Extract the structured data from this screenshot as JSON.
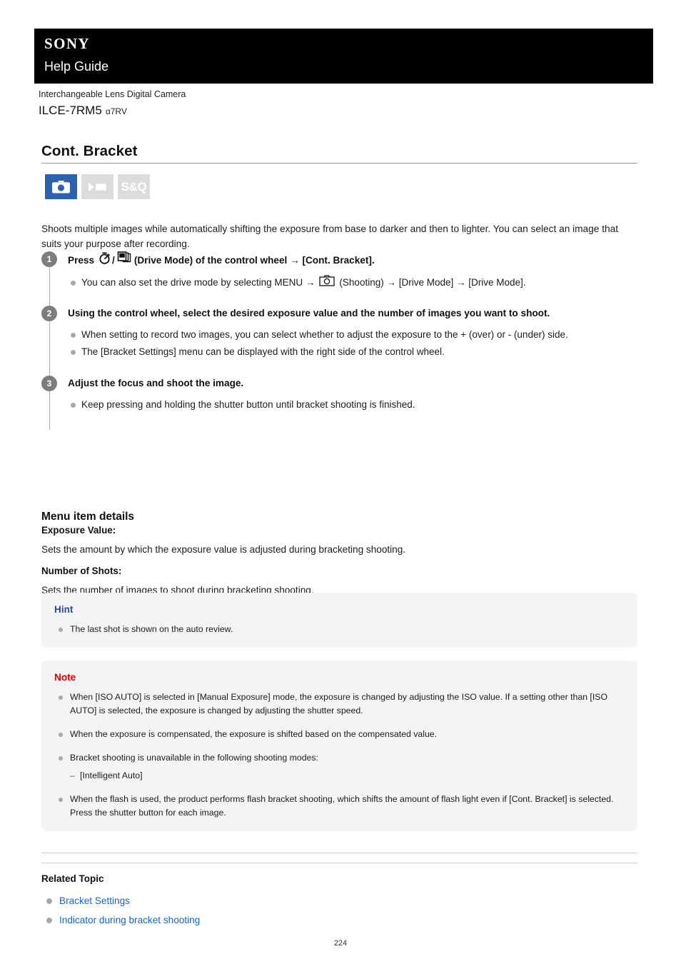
{
  "header": {
    "brand": "SONY",
    "subtitle": "Help Guide"
  },
  "product": {
    "category": "Interchangeable Lens Digital Camera",
    "model": "ILCE-7RM5",
    "alias": "α7RV"
  },
  "page_title": "Cont. Bracket",
  "mode_icons": [
    {
      "name": "still-photo-mode",
      "label": "",
      "state": "active"
    },
    {
      "name": "movie-mode",
      "label": "",
      "state": "inactive"
    },
    {
      "name": "slow-quick-mode",
      "label": "S&Q",
      "state": "inactive"
    }
  ],
  "intro": "Shoots multiple images while automatically shifting the exposure from base to darker and then to lighter. You can select an image that suits your purpose after recording.",
  "steps": [
    {
      "number": "1",
      "title_pre": "Press",
      "title_mid": "/",
      "title_post": "(Drive Mode) of the control wheel → [Cont. Bracket].",
      "bullets_pre": "You can also set the drive mode by selecting MENU →",
      "bullets_post": "(Shooting) → [Drive Mode] → [Drive Mode]."
    },
    {
      "number": "2",
      "title": "Using the control wheel, select the desired exposure value and the number of images you want to shoot.",
      "bullets": [
        "When setting to record two images, you can select whether to adjust the exposure to the + (over) or - (under) side.",
        "The [Bracket Settings] menu can be displayed with the right side of the control wheel."
      ]
    },
    {
      "number": "3",
      "title": "Adjust the focus and shoot the image.",
      "bullets": [
        "Keep pressing and holding the shutter button until bracket shooting is finished."
      ]
    }
  ],
  "menu_item_details": {
    "heading": "Menu item details",
    "entries": [
      {
        "term": "Exposure Value:",
        "desc": "Sets the amount by which the exposure value is adjusted during bracketing shooting."
      },
      {
        "term": "Number of Shots:",
        "desc": "Sets the number of images to shoot during bracketing shooting."
      }
    ]
  },
  "hint": {
    "title": "Hint",
    "items": [
      "The last shot is shown on the auto review."
    ]
  },
  "note": {
    "title": "Note",
    "items": [
      "When [ISO AUTO] is selected in [Manual Exposure] mode, the exposure is changed by adjusting the ISO value. If a setting other than [ISO AUTO] is selected, the exposure is changed by adjusting the shutter speed.",
      "When the exposure is compensated, the exposure is shifted based on the compensated value.",
      "Bracket shooting is unavailable in the following shooting modes:",
      "When the flash is used, the product performs flash bracket shooting, which shifts the amount of flash light even if [Cont. Bracket] is selected. Press the shutter button for each image."
    ],
    "sub_item": "[Intelligent Auto]"
  },
  "related": {
    "heading": "Related Topic",
    "links": [
      "Bracket Settings",
      "Indicator during bracket shooting"
    ]
  },
  "page_number": "224",
  "colors": {
    "header_bg": "#000000",
    "mode_active": "#2f62ad",
    "mode_inactive": "#dcdcdc",
    "hint_label": "#2a4b9b",
    "note_label": "#e60000",
    "link": "#1763c8",
    "panel_bg": "#f4f4f4",
    "step_marker": "#7d7d7d"
  }
}
